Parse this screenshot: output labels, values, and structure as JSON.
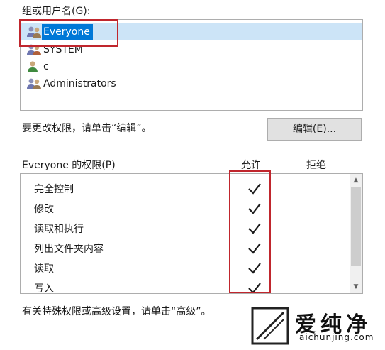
{
  "groups_label": "组或用户名(G):",
  "users": [
    {
      "name": "Everyone",
      "icon": "group-icon",
      "selected": true
    },
    {
      "name": "SYSTEM",
      "icon": "group-icon",
      "selected": false
    },
    {
      "name": "c",
      "icon": "user-icon",
      "selected": false
    },
    {
      "name": "Administrators",
      "icon": "group-icon",
      "selected": false
    }
  ],
  "edit_hint": "要更改权限，请单击“编辑”。",
  "edit_button": "编辑(E)...",
  "permissions_label": "Everyone 的权限(P)",
  "allow_header": "允许",
  "deny_header": "拒绝",
  "permissions": [
    {
      "name": "完全控制",
      "allow": true,
      "deny": false
    },
    {
      "name": "修改",
      "allow": true,
      "deny": false
    },
    {
      "name": "读取和执行",
      "allow": true,
      "deny": false
    },
    {
      "name": "列出文件夹内容",
      "allow": true,
      "deny": false
    },
    {
      "name": "读取",
      "allow": true,
      "deny": false
    },
    {
      "name": "写入",
      "allow": true,
      "deny": false
    }
  ],
  "advanced_hint": "有关特殊权限或高级设置，请单击“高级”。",
  "watermark": {
    "title": "爱纯净",
    "url": "aichunjing.com"
  },
  "colors": {
    "selection": "#0078d7",
    "highlight_box": "#c0262d",
    "checkmark": "#1a1a1a"
  }
}
